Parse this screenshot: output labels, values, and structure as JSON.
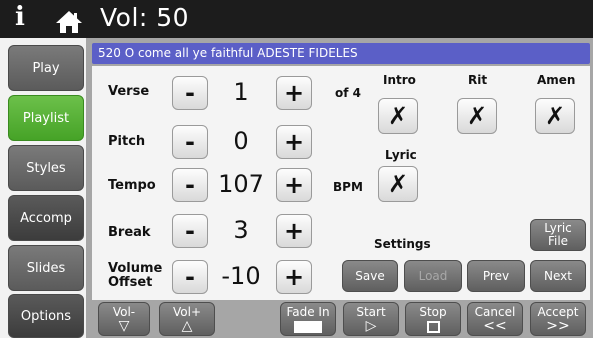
{
  "topbar": {
    "info_icon": "i",
    "home_icon": "home-icon",
    "volume": "Vol: 50"
  },
  "tabs": [
    {
      "label": "Play",
      "state": "normal"
    },
    {
      "label": "Playlist",
      "state": "active"
    },
    {
      "label": "Styles",
      "state": "normal"
    },
    {
      "label": "Accomp",
      "state": "dark"
    },
    {
      "label": "Slides",
      "state": "normal"
    },
    {
      "label": "Options",
      "state": "dark"
    }
  ],
  "song_title": "520  O come all ye faithful  ADESTE FIDELES",
  "controls": {
    "verse": {
      "label": "Verse",
      "minus": "-",
      "value": "1",
      "plus": "+",
      "suffix": "of 4"
    },
    "pitch": {
      "label": "Pitch",
      "minus": "-",
      "value": "0",
      "plus": "+"
    },
    "tempo": {
      "label": "Tempo",
      "minus": "-",
      "value": "107",
      "plus": "+",
      "suffix": "BPM"
    },
    "break": {
      "label": "Break",
      "minus": "-",
      "value": "3",
      "plus": "+"
    },
    "volume_offset": {
      "label_line1": "Volume",
      "label_line2": "Offset",
      "minus": "-",
      "value": "-10",
      "plus": "+"
    }
  },
  "toggles": {
    "intro": {
      "label": "Intro",
      "mark": "✗"
    },
    "rit": {
      "label": "Rit",
      "mark": "✗"
    },
    "amen": {
      "label": "Amen",
      "mark": "✗"
    },
    "lyric": {
      "label": "Lyric",
      "mark": "✗"
    }
  },
  "lyric_file": {
    "line1": "Lyric",
    "line2": "File"
  },
  "settings": {
    "label": "Settings",
    "save": "Save",
    "load": "Load",
    "prev": "Prev",
    "next": "Next"
  },
  "bottom": {
    "vol_down": {
      "label": "Vol-",
      "symbol": "▽"
    },
    "vol_up": {
      "label": "Vol+",
      "symbol": "△"
    },
    "fade_in": {
      "label": "Fade In"
    },
    "start": {
      "label": "Start",
      "symbol": "▷"
    },
    "stop": {
      "label": "Stop"
    },
    "cancel": {
      "label": "Cancel",
      "symbol": "<<"
    },
    "accept": {
      "label": "Accept",
      "symbol": ">>"
    }
  },
  "colors": {
    "accent_active_tab": "#55b030",
    "title_bar": "#5b5fc7",
    "top_bar": "#1c1c1c"
  }
}
